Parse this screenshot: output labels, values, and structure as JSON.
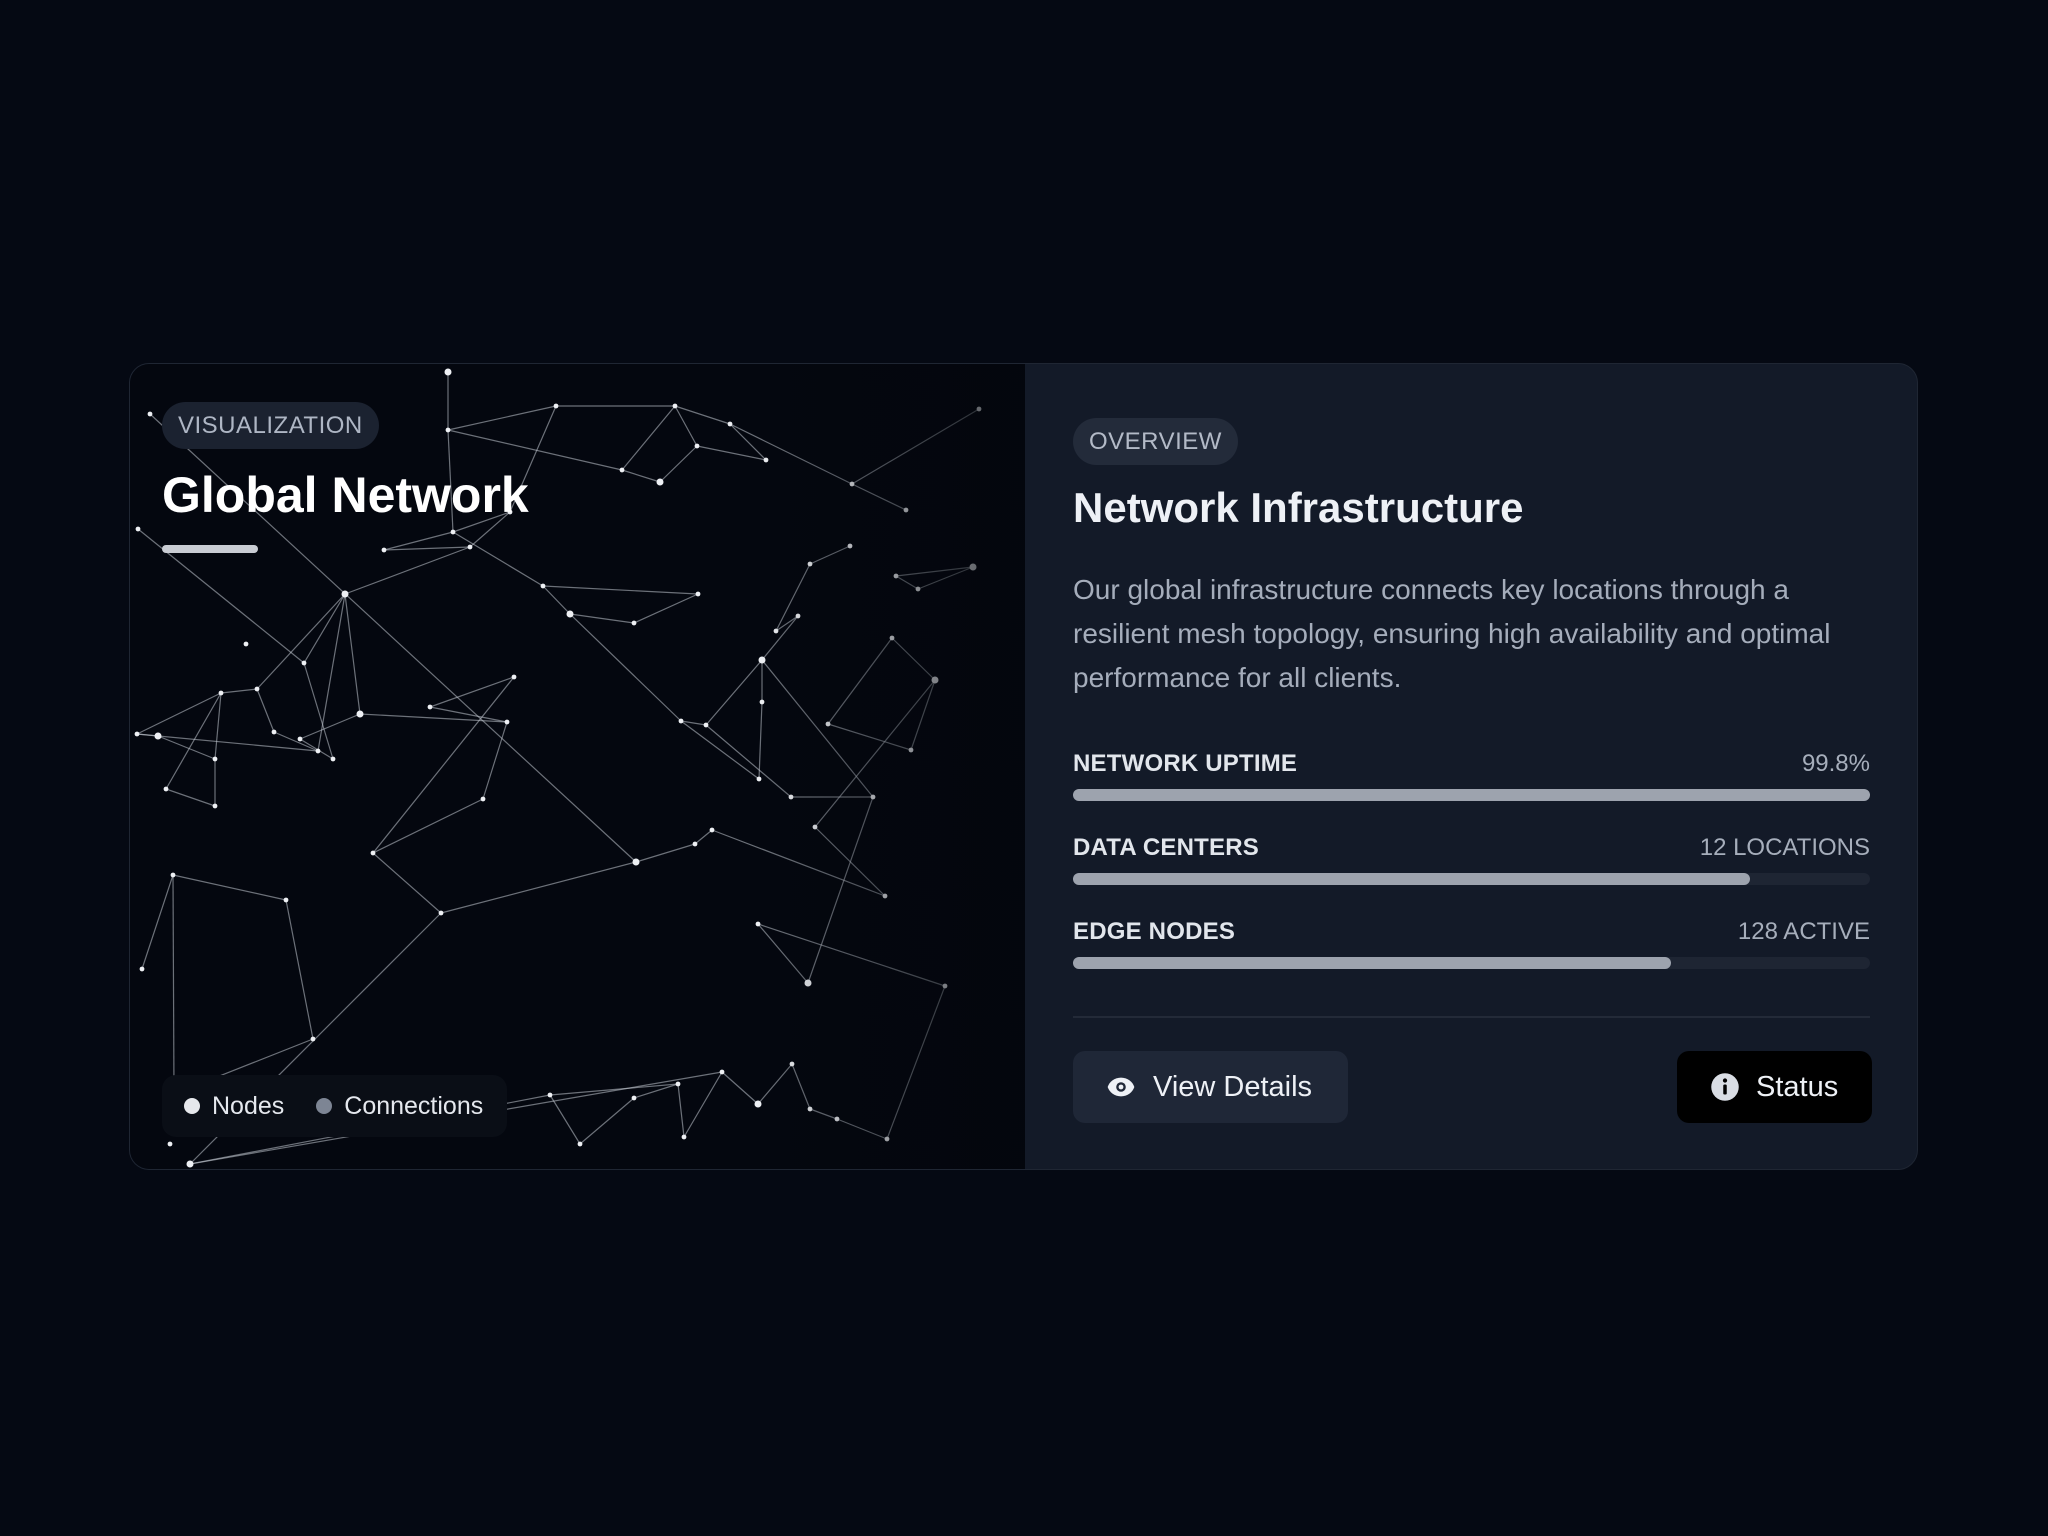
{
  "visualization": {
    "badge": "VISUALIZATION",
    "title": "Global Network",
    "legend": {
      "nodes_label": "Nodes",
      "connections_label": "Connections"
    }
  },
  "overview": {
    "badge": "OVERVIEW",
    "title": "Network Infrastructure",
    "description": "Our global infrastructure connects key locations through a resilient mesh topology, ensuring high availability and optimal performance for all clients.",
    "metrics": [
      {
        "label": "NETWORK UPTIME",
        "value": "99.8%",
        "progress": 1.0
      },
      {
        "label": "DATA CENTERS",
        "value": "12 LOCATIONS",
        "progress": 0.85
      },
      {
        "label": "EDGE NODES",
        "value": "128 ACTIVE",
        "progress": 0.75
      }
    ],
    "buttons": {
      "details": "View Details",
      "status": "Status"
    }
  },
  "icons": [
    "eye-icon",
    "info-icon"
  ],
  "colors": {
    "background": "#050913",
    "panel": "#131a28",
    "accent_fill": "#9da3ae"
  }
}
